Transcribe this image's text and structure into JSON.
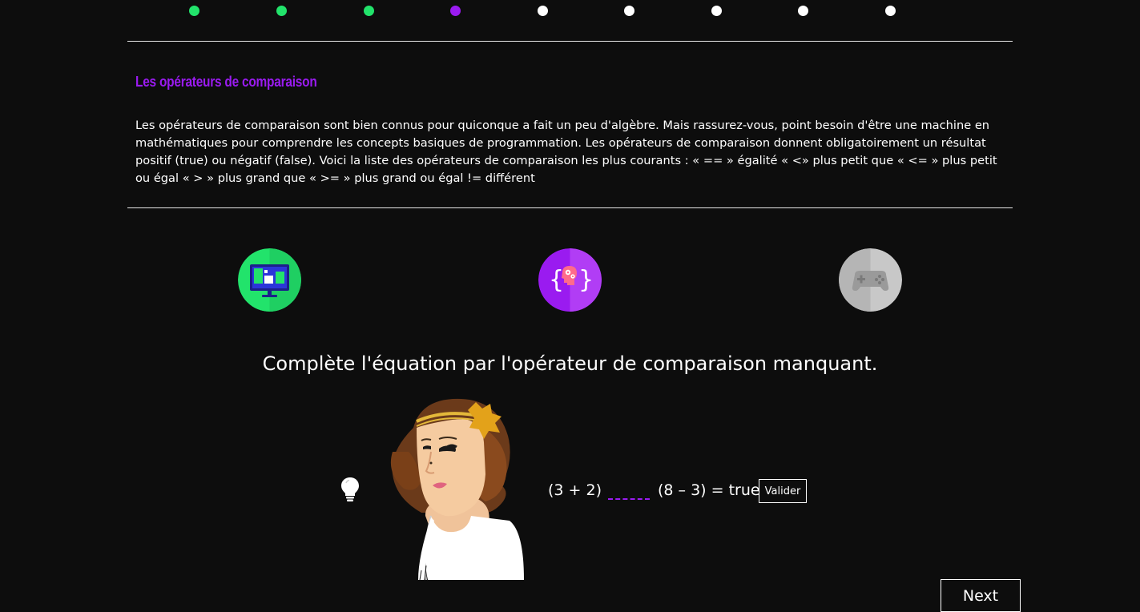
{
  "progress": {
    "steps": [
      {
        "state": "done"
      },
      {
        "state": "done"
      },
      {
        "state": "done"
      },
      {
        "state": "current"
      },
      {
        "state": "todo"
      },
      {
        "state": "todo"
      },
      {
        "state": "todo"
      },
      {
        "state": "todo"
      },
      {
        "state": "todo"
      }
    ],
    "colors": {
      "done": "#22e36b",
      "current": "#9a1bf0",
      "todo": "#ffffff"
    }
  },
  "lesson": {
    "title": "Les opérateurs de comparaison",
    "body": "Les opérateurs de comparaison sont bien connus pour quiconque a fait un peu d'algèbre. Mais rassurez-vous, point besoin d'être une machine en mathématiques pour comprendre les concepts basiques de programmation. Les opérateurs de comparaison donnent obligatoirement un résultat positif (true) ou négatif (false). Voici la liste des opérateurs de comparaison les plus courants : « == » égalité « <» plus petit que « <= » plus petit ou égal « > » plus grand que « >= » plus grand ou égal != différent"
  },
  "badges": [
    {
      "icon": "computer-screen-icon",
      "color": "#22e36b",
      "state": "active"
    },
    {
      "icon": "code-brain-icon",
      "color": "#9a1bf0",
      "state": "active"
    },
    {
      "icon": "game-controller-icon",
      "color": "#b8b8b8",
      "state": "locked"
    }
  ],
  "exercise": {
    "question": "Complète l'équation par l'opérateur de comparaison manquant.",
    "left_operand": "(3 + 2)",
    "right_operand": "(8 – 3) = true;",
    "answer_value": "",
    "validate_label": "Valider",
    "hint_icon": "lightbulb-icon",
    "character": "woman-with-headband-avatar"
  },
  "navigation": {
    "next_label": "Next"
  },
  "theme": {
    "background": "#0d0d0d",
    "accent": "#9a1bf0",
    "success": "#22e36b",
    "text": "#ffffff"
  }
}
